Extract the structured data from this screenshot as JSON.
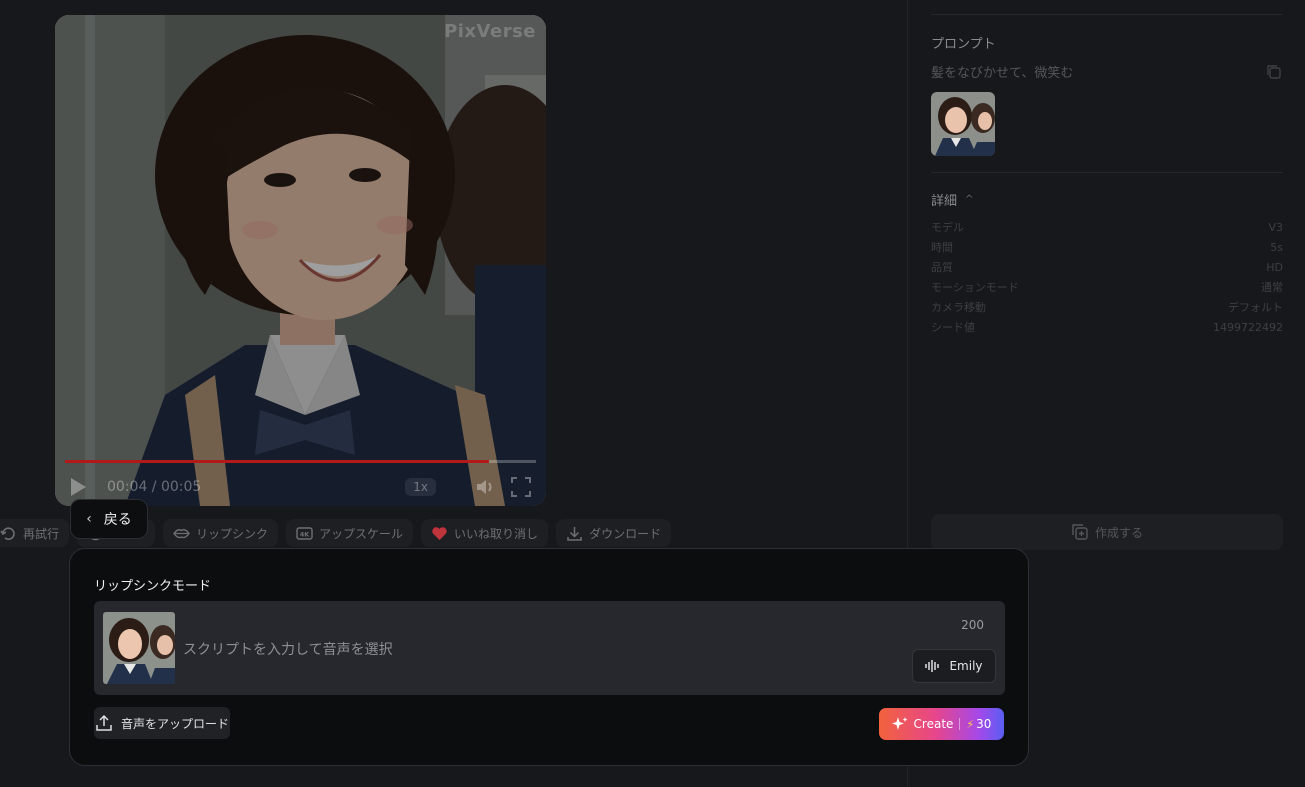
{
  "video": {
    "watermark": "PixVerse",
    "current_time": "00:04 / 00:05",
    "speed": "1x",
    "progress_fraction": 0.9
  },
  "actions": {
    "retry": "再試行",
    "lip_sync": "リップシンク",
    "upscale": "アップスケール",
    "unlike": "いいね取り消し",
    "download": "ダウンロード",
    "back": "戻る"
  },
  "panel": {
    "prompt_title": "プロンプト",
    "prompt_text": "髪をなびかせて、微笑む",
    "details_title": "詳細",
    "details": [
      {
        "label": "モデル",
        "value": "V3"
      },
      {
        "label": "時間",
        "value": "5s"
      },
      {
        "label": "品質",
        "value": "HD"
      },
      {
        "label": "モーションモード",
        "value": "通常"
      },
      {
        "label": "カメラ移動",
        "value": "デフォルト"
      },
      {
        "label": "シード値",
        "value": "1499722492"
      }
    ],
    "create_label": "作成する"
  },
  "lipsync": {
    "title": "リップシンクモード",
    "placeholder": "スクリプトを入力して音声を選択",
    "char_limit": "200",
    "voice": "Emily",
    "upload_label": "音声をアップロード",
    "create_label": "Create",
    "credits": "30"
  },
  "colors": {
    "background": "#17181b",
    "progress": "#b21a1a",
    "create_gradient_start": "#f2623c",
    "create_gradient_end": "#5a5ef3"
  }
}
